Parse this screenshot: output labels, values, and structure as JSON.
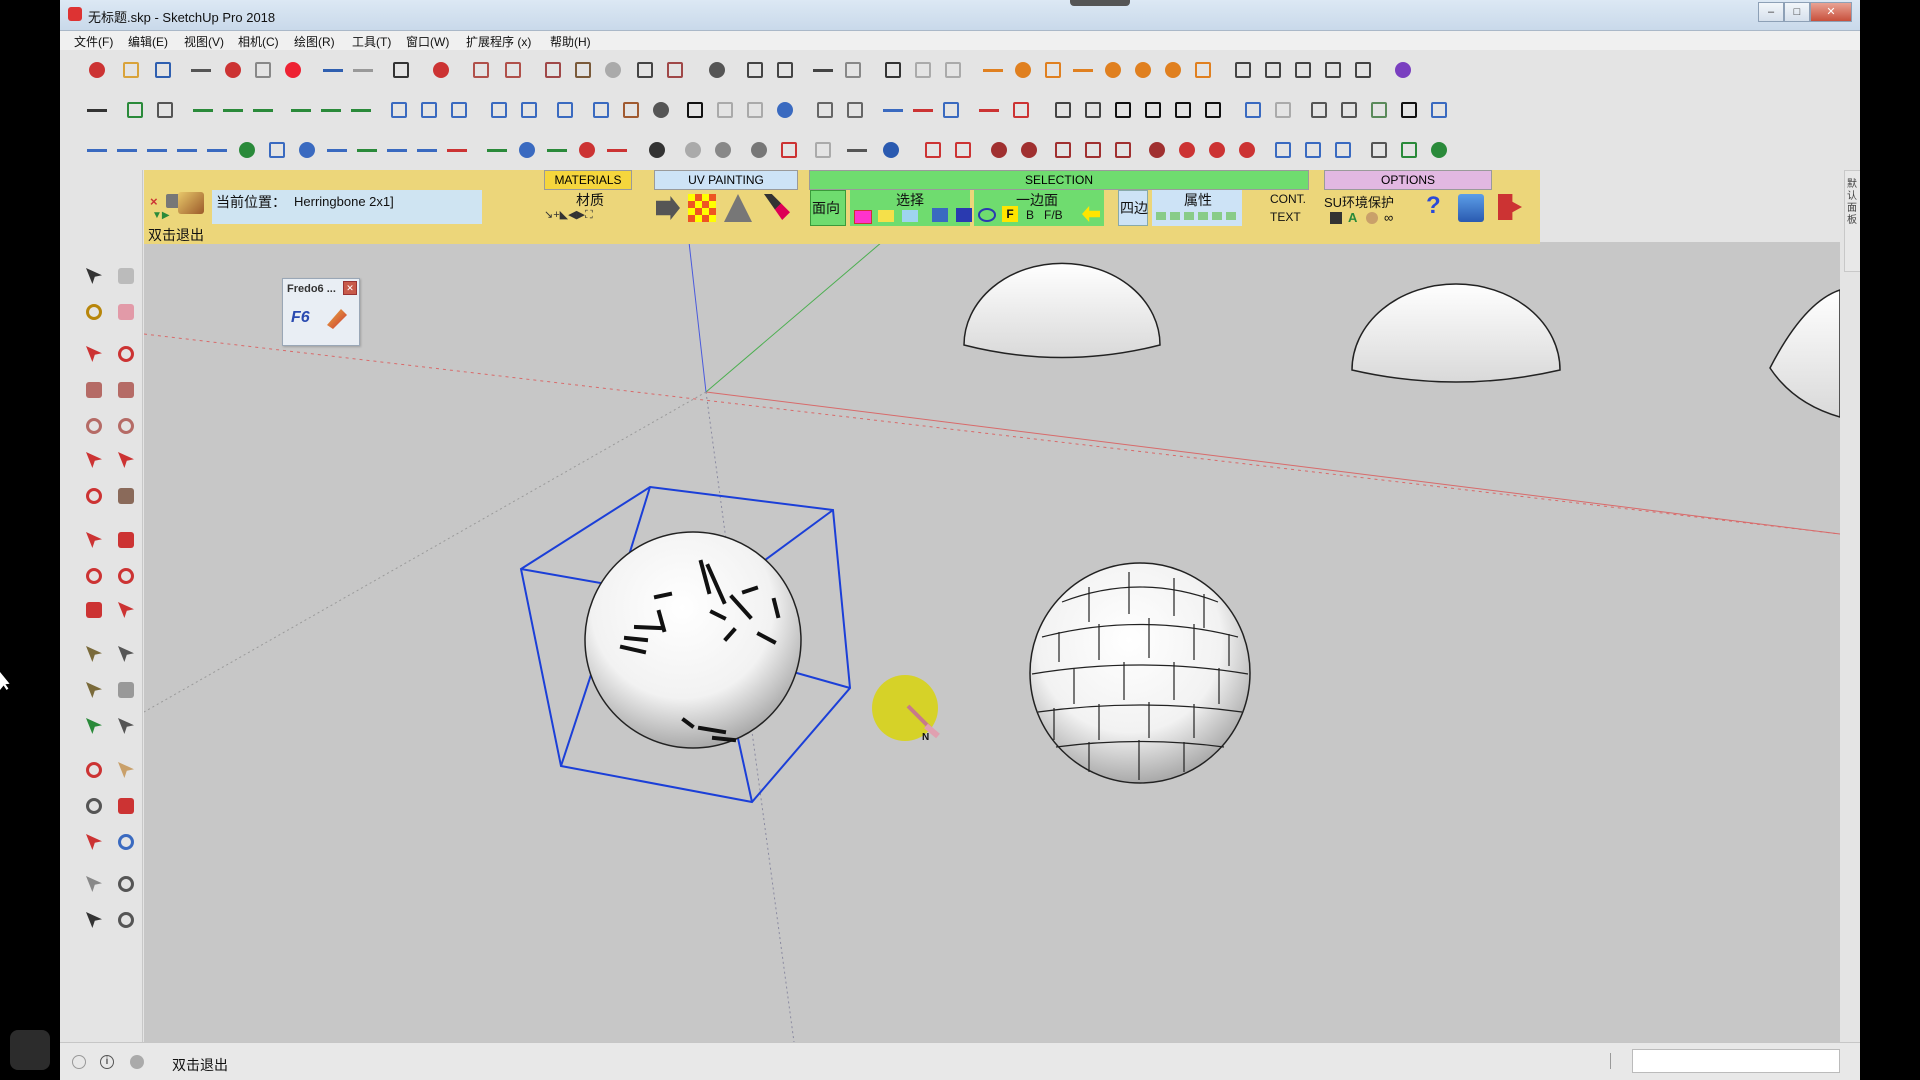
{
  "window": {
    "title": "无标题.skp - SketchUp Pro 2018",
    "controls": [
      "–",
      "□",
      "✕"
    ]
  },
  "menu": {
    "items": [
      "文件(F)",
      "编辑(E)",
      "视图(V)",
      "相机(C)",
      "绘图(R)",
      "工具(T)",
      "窗口(W)",
      "扩展程序 (x)",
      "帮助(H)"
    ]
  },
  "plugin_panel": {
    "close_label": "×",
    "current_position_label": "当前位置：",
    "current_position_value": "Herringbone 2x1]",
    "exit_hint": "双击退出",
    "tabs": {
      "materials": "MATERIALS",
      "uv_painting": "UV PAINTING",
      "selection": "SELECTION",
      "options": "OPTIONS"
    },
    "material_label": "材质",
    "face_label": "面向",
    "select_label": "选择",
    "one_side_label": "一边面",
    "four_sides_label": "四边",
    "attribute_label": "属性",
    "cont_label": "CONT.",
    "text_label": "TEXT",
    "su_protect_label": "SU环境保护",
    "letters": {
      "f": "F",
      "b": "B",
      "fb": "F/B",
      "a": "A",
      "help": "?"
    }
  },
  "fredo_window": {
    "title": "Fredo6 ...",
    "logo_text": "F6"
  },
  "viewport": {
    "background": "#c7c7c7",
    "axis_red": "#d86a6a",
    "axis_green": "#4caf50",
    "axis_blue": "#4a5adc"
  },
  "statusbar": {
    "hint": "双击退出"
  },
  "right_dock": {
    "label": "默认面板"
  },
  "cursor_marker": {
    "letter": "N"
  }
}
